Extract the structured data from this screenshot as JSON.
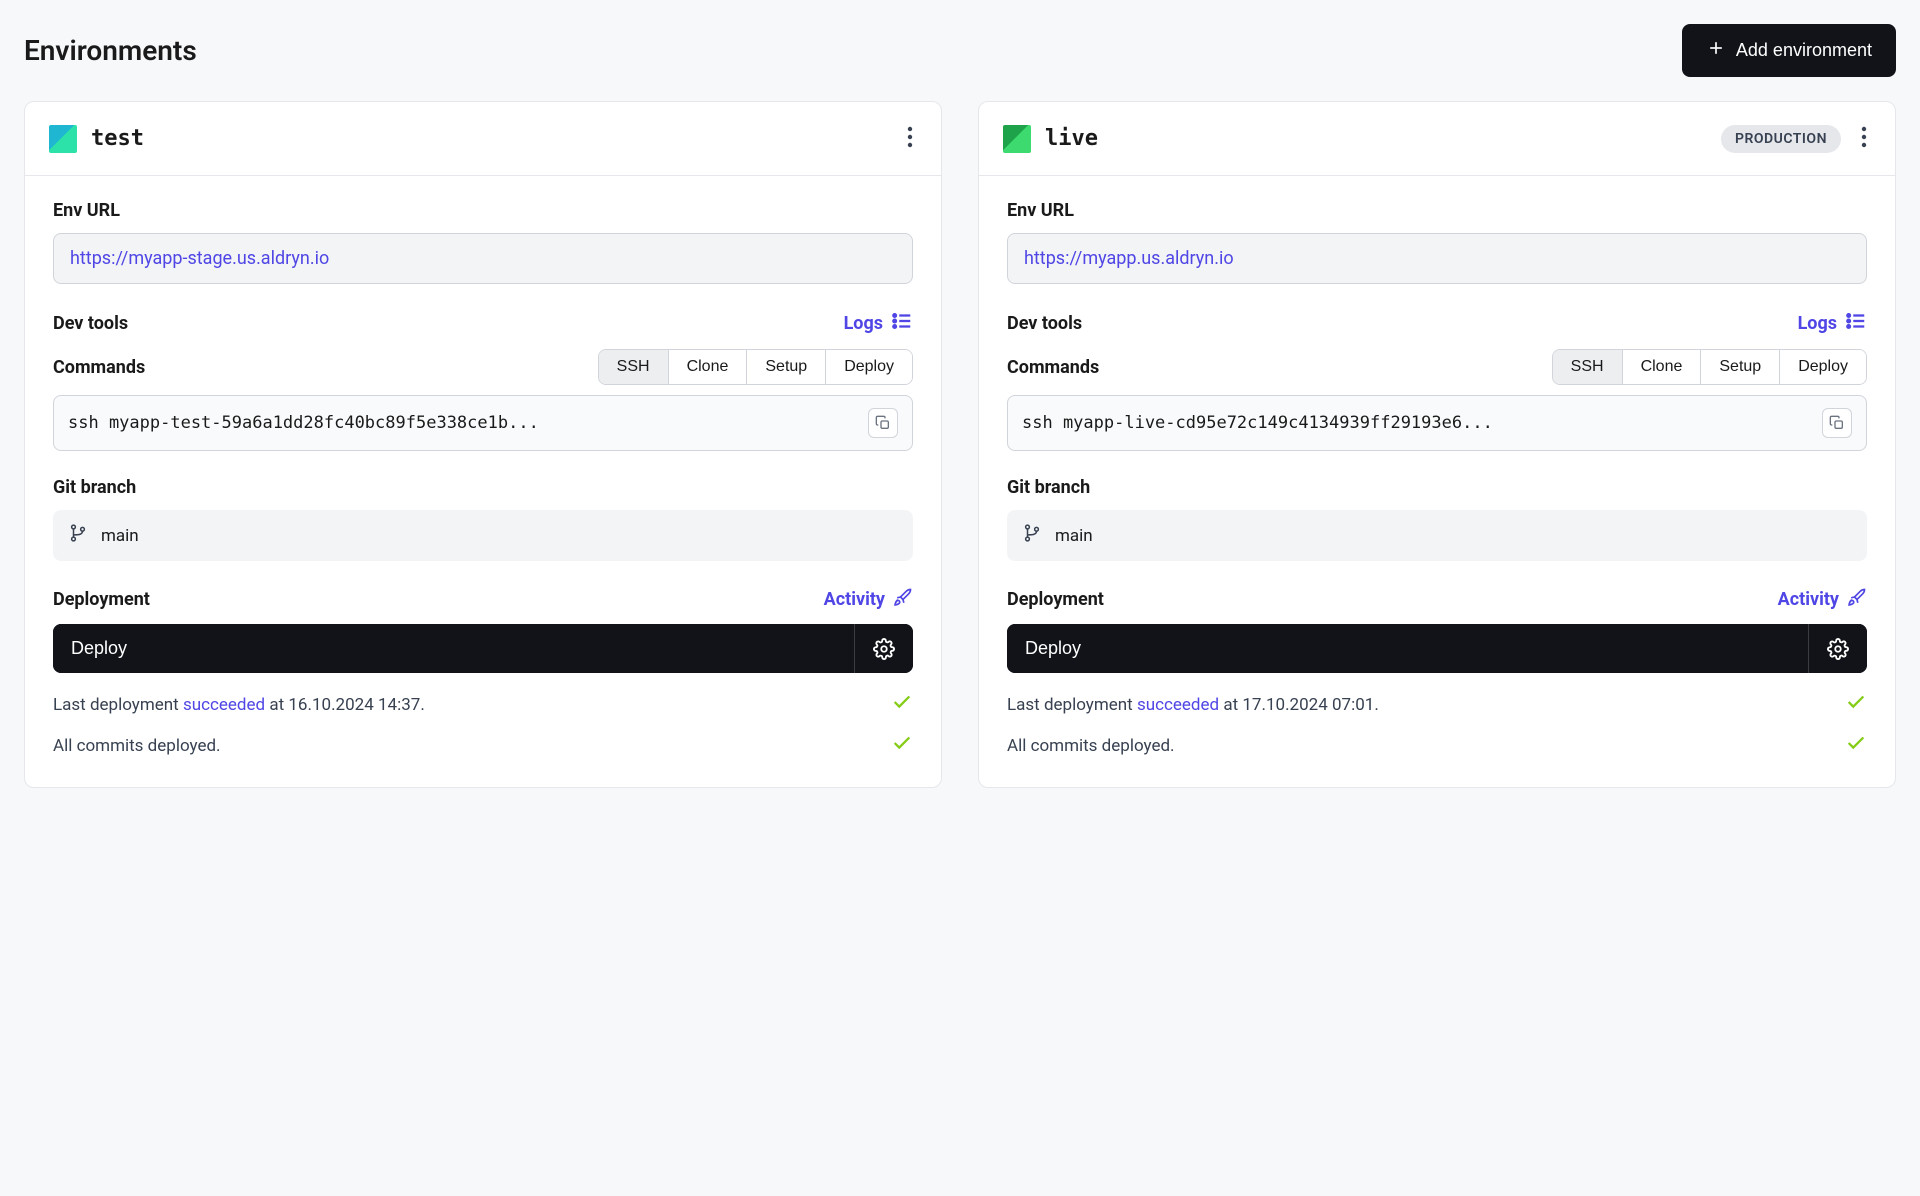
{
  "page": {
    "title": "Environments",
    "add_button": "Add environment"
  },
  "sections": {
    "env_url": "Env URL",
    "dev_tools": "Dev tools",
    "logs": "Logs",
    "commands": "Commands",
    "git_branch": "Git branch",
    "deployment": "Deployment",
    "activity": "Activity",
    "deploy_btn": "Deploy"
  },
  "tabs": {
    "ssh": "SSH",
    "clone": "Clone",
    "setup": "Setup",
    "deploy": "Deploy"
  },
  "environments": [
    {
      "name": "test",
      "badge": null,
      "icon_class": "env-icon-test",
      "url": "https://myapp-stage.us.aldryn.io",
      "active_tab": "SSH",
      "command": "ssh myapp-test-59a6a1dd28fc40bc89f5e338ce1b...",
      "branch": "main",
      "last_deployment": {
        "prefix": "Last deployment ",
        "status": "succeeded",
        "suffix": " at 16.10.2024 14:37."
      },
      "commits_status": "All commits deployed."
    },
    {
      "name": "live",
      "badge": "PRODUCTION",
      "icon_class": "env-icon-live",
      "url": "https://myapp.us.aldryn.io",
      "active_tab": "SSH",
      "command": "ssh myapp-live-cd95e72c149c4134939ff29193e6...",
      "branch": "main",
      "last_deployment": {
        "prefix": "Last deployment ",
        "status": "succeeded",
        "suffix": " at 17.10.2024 07:01."
      },
      "commits_status": "All commits deployed."
    }
  ]
}
